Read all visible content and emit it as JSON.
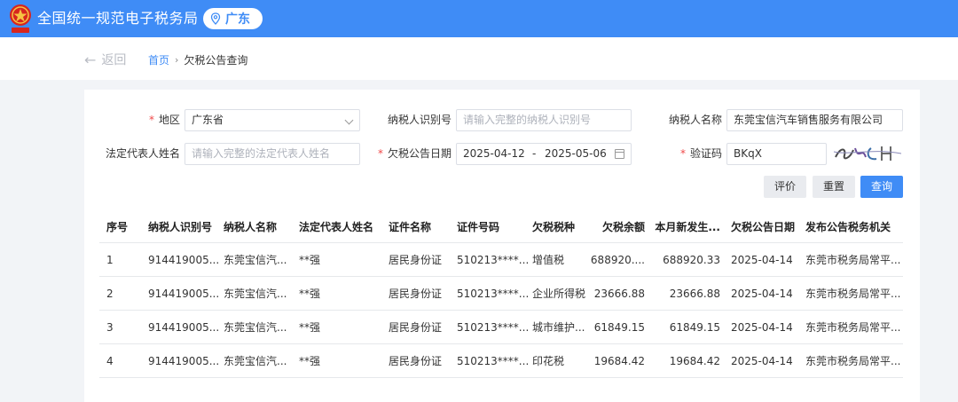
{
  "header": {
    "title": "全国统一规范电子税务局",
    "region": "广东",
    "brand_color": "#3f8cf6",
    "logo_icon": "tax-emblem-icon",
    "region_icon": "location-pin-icon"
  },
  "breadcrumb": {
    "back_label": "返回",
    "home": "首页",
    "current": "欠税公告查询"
  },
  "form": {
    "region_label": "地区",
    "region_value": "广东省",
    "taxpayer_id_label": "纳税人识别号",
    "taxpayer_id_placeholder": "请输入完整的纳税人识别号",
    "taxpayer_name_label": "纳税人名称",
    "taxpayer_name_value": "东莞宝信汽车销售服务有限公司",
    "legal_rep_label": "法定代表人姓名",
    "legal_rep_placeholder": "请输入完整的法定代表人姓名",
    "date_label": "欠税公告日期",
    "date_start": "2025-04-12",
    "date_sep": "-",
    "date_end": "2025-05-06",
    "captcha_label": "验证码",
    "captcha_value": "BKqX"
  },
  "buttons": {
    "rate": "评价",
    "reset": "重置",
    "search": "查询"
  },
  "table": {
    "headers": [
      "序号",
      "纳税人识别号",
      "纳税人名称",
      "法定代表人姓名",
      "证件名称",
      "证件号码",
      "欠税税种",
      "欠税余额",
      "本月新发生...",
      "欠税公告日期",
      "发布公告税务机关"
    ],
    "rows": [
      [
        "1",
        "914419005...",
        "东莞宝信汽...",
        "**强",
        "居民身份证",
        "510213****...",
        "增值税",
        "688920....",
        "688920.33",
        "2025-04-14",
        "东莞市税务局常平..."
      ],
      [
        "2",
        "914419005...",
        "东莞宝信汽...",
        "**强",
        "居民身份证",
        "510213****...",
        "企业所得税",
        "23666.88",
        "23666.88",
        "2025-04-14",
        "东莞市税务局常平..."
      ],
      [
        "3",
        "914419005...",
        "东莞宝信汽...",
        "**强",
        "居民身份证",
        "510213****...",
        "城市维护...",
        "61849.15",
        "61849.15",
        "2025-04-14",
        "东莞市税务局常平..."
      ],
      [
        "4",
        "914419005...",
        "东莞宝信汽...",
        "**强",
        "居民身份证",
        "510213****...",
        "印花税",
        "19684.42",
        "19684.42",
        "2025-04-14",
        "东莞市税务局常平..."
      ]
    ]
  }
}
